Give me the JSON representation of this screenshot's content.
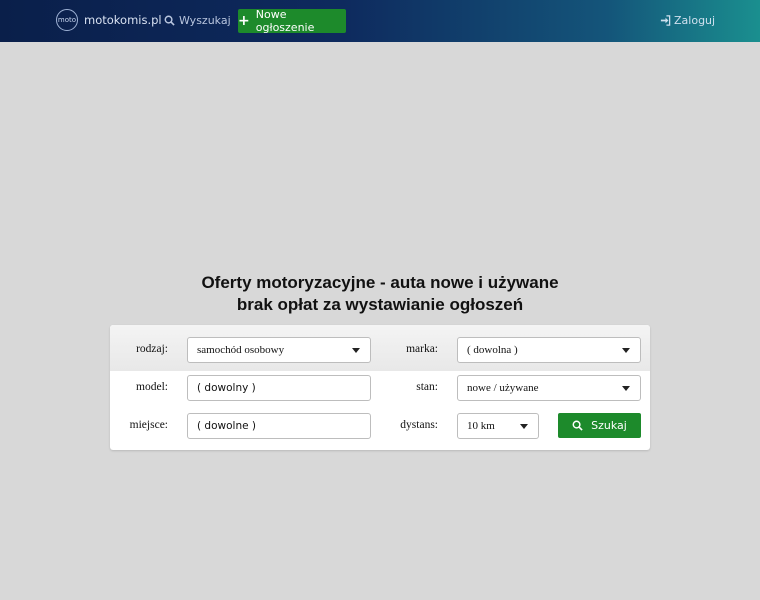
{
  "nav": {
    "logo_text": "motokomis.pl",
    "logo_badge": "moto",
    "search_label": "Wyszukaj",
    "new_ad_label": "Nowe ogłoszenie",
    "login_label": "Zaloguj"
  },
  "headline": {
    "line1": "Oferty motoryzacyjne - auta nowe i używane",
    "line2": "brak opłat za wystawianie ogłoszeń"
  },
  "form": {
    "rodzaj": {
      "label": "rodzaj:",
      "value": "samochód osobowy"
    },
    "marka": {
      "label": "marka:",
      "value": "( dowolna )"
    },
    "model": {
      "label": "model:",
      "value": "( dowolny )"
    },
    "stan": {
      "label": "stan:",
      "value": "nowe / używane"
    },
    "miejsce": {
      "label": "miejsce:",
      "value": "( dowolne )"
    },
    "dystans": {
      "label": "dystans:",
      "value": "10 km"
    },
    "search_button": "Szukaj"
  },
  "colors": {
    "accent_green": "#1d8a2b",
    "navbar_start": "#0a1f4a",
    "navbar_end": "#1a8f8f",
    "background": "#d8d8d8"
  }
}
